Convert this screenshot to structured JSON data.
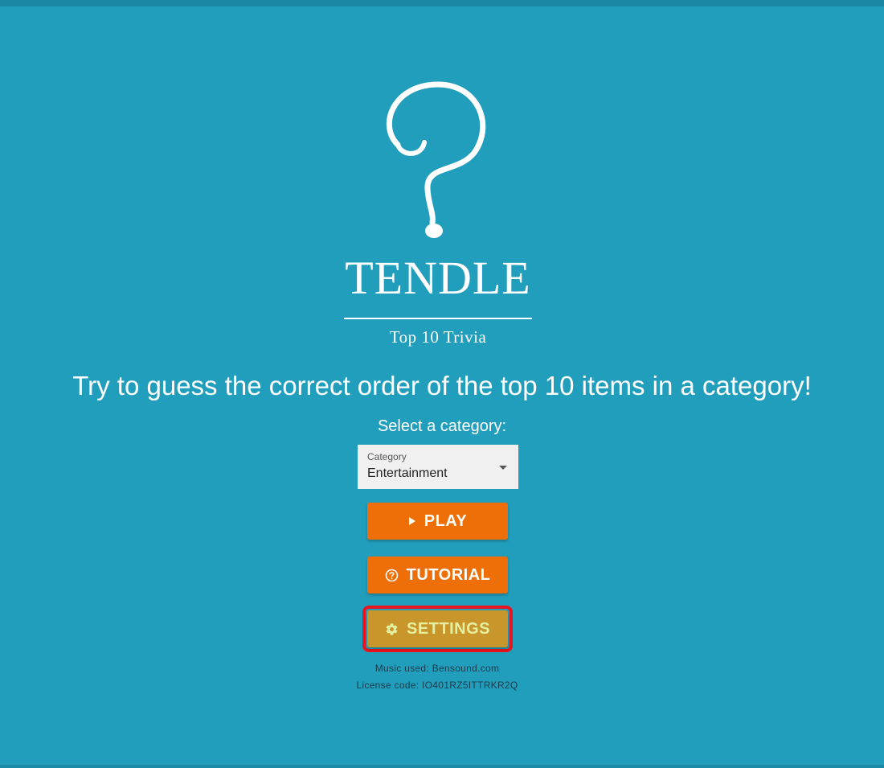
{
  "app": {
    "logo_title": "TENDLE",
    "logo_subtitle": "Top 10 Trivia"
  },
  "main": {
    "headline": "Try to guess the correct order of the top 10 items in a category!",
    "select_label": "Select a category:",
    "category": {
      "label": "Category",
      "value": "Entertainment"
    },
    "buttons": {
      "play": "PLAY",
      "tutorial": "TUTORIAL",
      "settings": "SETTINGS"
    }
  },
  "footer": {
    "music": "Music used: Bensound.com",
    "license": "License code: IO401RZ5ITTRKR2Q"
  },
  "icons": {
    "logo": "question-mark-icon",
    "play": "play-icon",
    "tutorial": "help-circle-icon",
    "settings": "gear-icon",
    "select": "caret-down-icon"
  },
  "colors": {
    "background": "#229ebd",
    "primary_button": "#ee6e07",
    "settings_button": "#c9962c",
    "settings_text": "#e4f0a0",
    "highlight": "#e8141e"
  }
}
